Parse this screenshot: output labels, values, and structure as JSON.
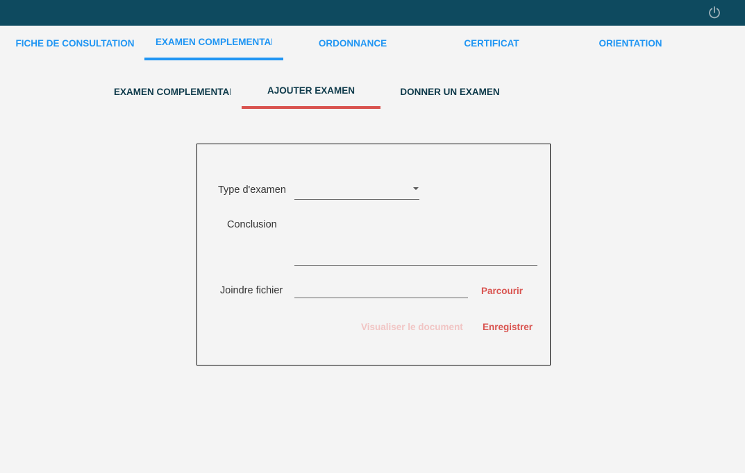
{
  "topbar": {
    "background": "#0e4a5f",
    "power_icon": "power-icon"
  },
  "main_tabs": [
    {
      "label": "FICHE DE CONSULTATION",
      "active": false
    },
    {
      "label": "EXAMEN COMPLEMENTAIRE",
      "active": true
    },
    {
      "label": "ORDONNANCE",
      "active": false
    },
    {
      "label": "CERTIFICAT",
      "active": false
    },
    {
      "label": "ORIENTATION",
      "active": false
    }
  ],
  "sub_tabs": [
    {
      "label": "EXAMEN COMPLEMENTAIRE",
      "active": false
    },
    {
      "label": "AJOUTER EXAMEN",
      "active": true
    },
    {
      "label": "DONNER UN EXAMEN",
      "active": false
    }
  ],
  "form": {
    "type_label": "Type d'examen",
    "type_value": "",
    "conclusion_label": "Conclusion",
    "conclusion_value": "",
    "file_label": "Joindre fichier",
    "file_value": "",
    "browse_button": "Parcourir",
    "view_button": "Visualiser le document",
    "save_button": "Enregistrer"
  },
  "colors": {
    "main_tab_text": "#2196f3",
    "main_tab_indicator": "#2196f3",
    "sub_tab_text": "#0e3a4a",
    "sub_tab_indicator": "#d9534f",
    "action_red": "#d9534f",
    "action_disabled": "#f1c5c4",
    "background": "#f4f4f4"
  }
}
